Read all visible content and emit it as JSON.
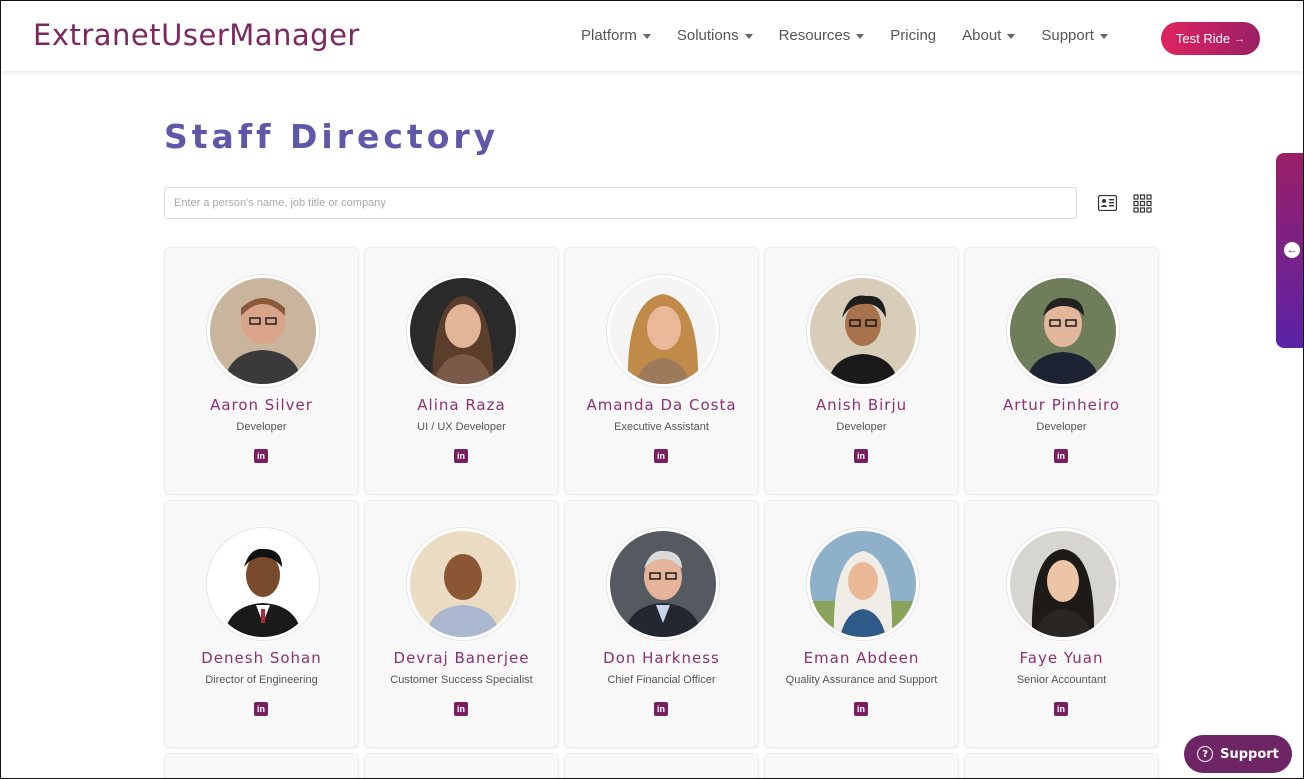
{
  "header": {
    "logo": "ExtranetUserManager",
    "nav": [
      {
        "label": "Platform",
        "dropdown": true
      },
      {
        "label": "Solutions",
        "dropdown": true
      },
      {
        "label": "Resources",
        "dropdown": true
      },
      {
        "label": "Pricing",
        "dropdown": false
      },
      {
        "label": "About",
        "dropdown": true
      },
      {
        "label": "Support",
        "dropdown": true
      }
    ],
    "cta_label": "Test Ride",
    "cta_arrow": "→"
  },
  "page_title": "Staff Directory",
  "search": {
    "placeholder": "Enter a person's name, job title or company",
    "value": ""
  },
  "linkedin_label": "in",
  "support_button": {
    "label": "Support",
    "icon": "?"
  },
  "side_tab_icon": "←",
  "colors": {
    "brand": "#7c2760",
    "title": "#5e58a8",
    "name": "#8b3272",
    "linkedin": "#7a1f5d",
    "cta_start": "#e0245e",
    "cta_end": "#9a1f66"
  },
  "staff": [
    {
      "name": "Aaron Silver",
      "title": "Developer"
    },
    {
      "name": "Alina Raza",
      "title": "UI / UX Developer"
    },
    {
      "name": "Amanda Da Costa",
      "title": "Executive Assistant"
    },
    {
      "name": "Anish Birju",
      "title": "Developer"
    },
    {
      "name": "Artur Pinheiro",
      "title": "Developer"
    },
    {
      "name": "Denesh Sohan",
      "title": "Director of Engineering"
    },
    {
      "name": "Devraj Banerjee",
      "title": "Customer Success Specialist"
    },
    {
      "name": "Don Harkness",
      "title": "Chief Financial Officer"
    },
    {
      "name": "Eman Abdeen",
      "title": "Quality Assurance and Support"
    },
    {
      "name": "Faye Yuan",
      "title": "Senior Accountant"
    }
  ]
}
